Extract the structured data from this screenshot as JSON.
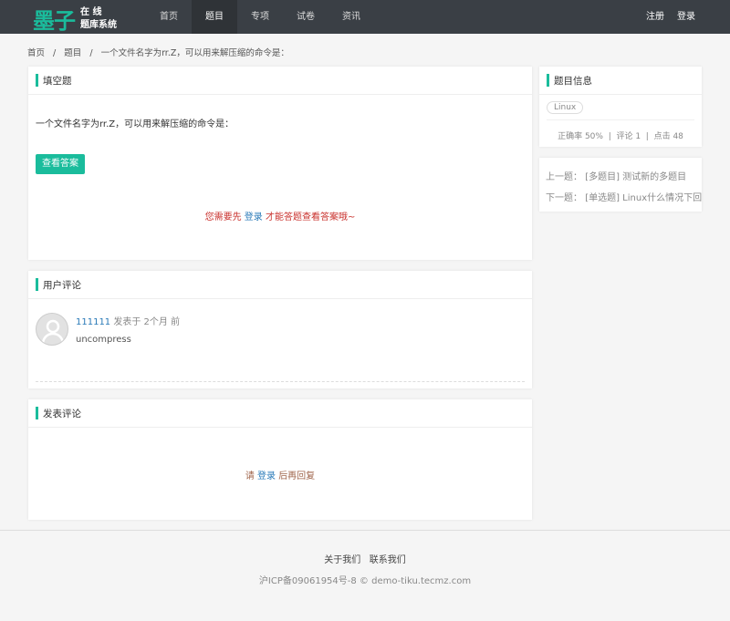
{
  "logo": {
    "big": "墨子",
    "line1": "在 线",
    "line2": "题库系统"
  },
  "nav": {
    "items": [
      "首页",
      "题目",
      "专项",
      "试卷",
      "资讯"
    ],
    "active": 1,
    "register": "注册",
    "login": "登录"
  },
  "breadcrumb": [
    "首页",
    "/",
    "题目",
    "/",
    "一个文件名字为rr.Z，可以用来解压缩的命令是："
  ],
  "question": {
    "type": "填空题",
    "text": "一个文件名字为rr.Z，可以用来解压缩的命令是：",
    "answer_button": "查看答案",
    "notice_pre": "您需要先",
    "notice_login": "登录",
    "notice_post": "才能答题查看答案哦~"
  },
  "comments": {
    "title": "用户评论",
    "items": [
      {
        "user": "111111",
        "meta": "发表于 2个月 前",
        "text": "uncompress"
      }
    ]
  },
  "post": {
    "title": "发表评论",
    "pre": "请",
    "login": "登录",
    "post": "后再回复"
  },
  "info": {
    "title": "题目信息",
    "tag": "Linux",
    "accuracy": "正确率 50%",
    "sep": "|",
    "comments": "评论 1",
    "clicks": "点击 48"
  },
  "nav_q": {
    "prev_label": "上一题：",
    "prev": "[多题目] 测试新的多题目",
    "next_label": "下一题：",
    "next": "[单选题] Linux什么情况下回"
  },
  "footer": {
    "about": "关于我们",
    "contact": "联系我们",
    "icp": "沪ICP备09061954号-8 © demo-tiku.tecmz.com"
  },
  "colors": {
    "accent": "#1abc9c",
    "nav_bg": "#3a3f45"
  }
}
